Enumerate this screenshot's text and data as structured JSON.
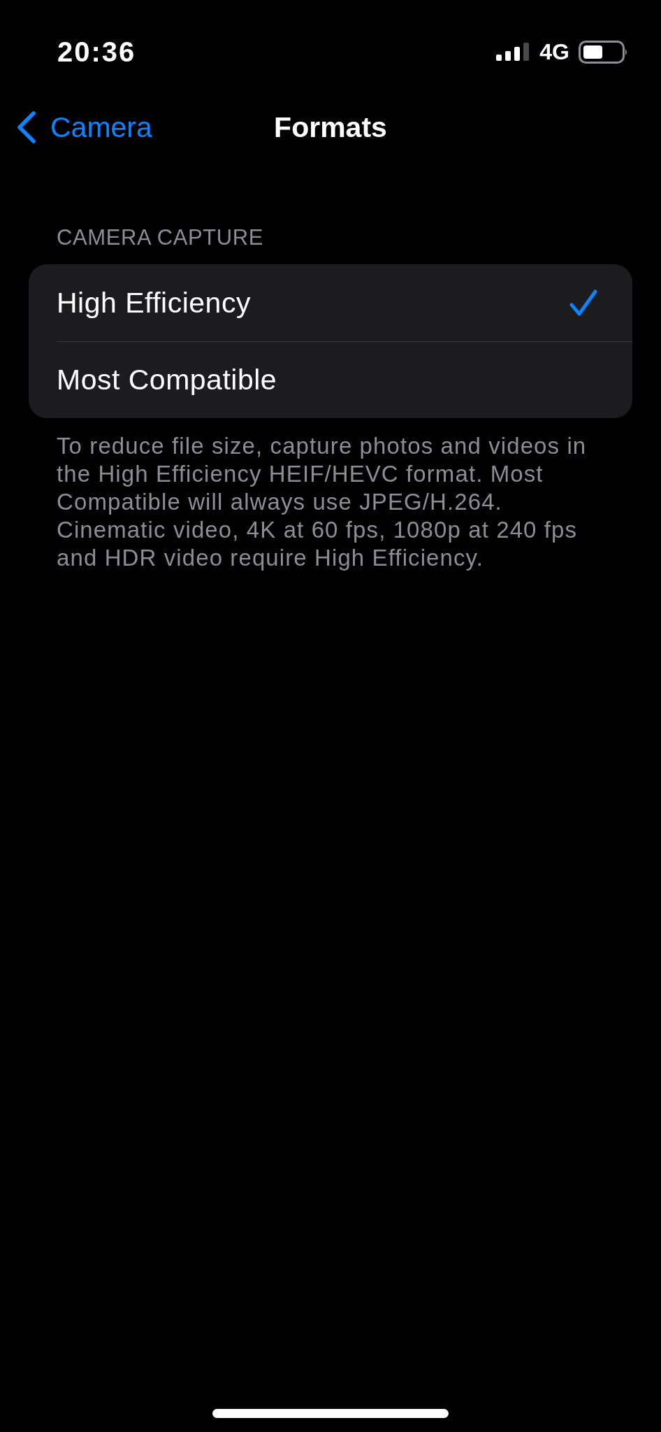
{
  "status_bar": {
    "time": "20:36",
    "network": "4G"
  },
  "nav_bar": {
    "back_label": "Camera",
    "title": "Formats"
  },
  "sections": [
    {
      "header": "CAMERA CAPTURE",
      "options": [
        {
          "label": "High Efficiency",
          "selected": true
        },
        {
          "label": "Most Compatible",
          "selected": false
        }
      ],
      "footer": "To reduce file size, capture photos and videos in the High Efficiency HEIF/HEVC format. Most Compatible will always use JPEG/H.264. Cinematic video, 4K at 60 fps, 1080p at 240 fps and HDR video require High Efficiency."
    }
  ]
}
